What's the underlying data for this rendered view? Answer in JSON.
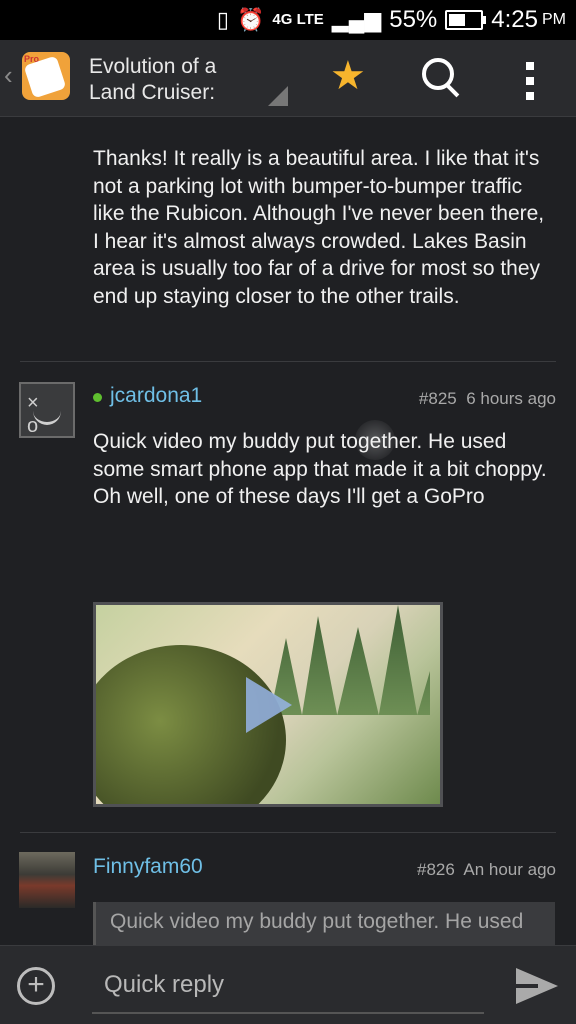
{
  "status_bar": {
    "vibrate_icon": "vibrate-icon",
    "alarm_icon": "alarm-icon",
    "network": "4G LTE",
    "signal_icon": "signal-icon",
    "battery": "55%",
    "battery_level": 0.55,
    "time": "4:25",
    "ampm": "PM"
  },
  "action_bar": {
    "title_line1": "Evolution of a",
    "title_line2": "Land Cruiser:",
    "app_icon_badge": "Pro",
    "star_icon": "star-icon",
    "search_icon": "search-icon",
    "menu_icon": "overflow-menu-icon",
    "accent": "#f7b52d"
  },
  "posts": [
    {
      "text": "Thanks! It really is a beautiful area. I like that it's not a parking lot with bumper-to-bumper traffic like the Rubicon. Although I've never been there, I hear it's almost always crowded. Lakes Basin area is usually too far of a drive for most so they end up staying closer to the other trails."
    },
    {
      "username": "jcardona1",
      "online": true,
      "post_number": "#825",
      "time": "6 hours ago",
      "text": "Quick video my buddy put together. He used some smart phone app that made it a bit choppy. Oh well, one of these days I'll get a GoPro",
      "video": {
        "play_icon": "play-icon"
      }
    },
    {
      "username": "Finnyfam60",
      "post_number": "#826",
      "time": "An hour ago",
      "quote": "Quick video my buddy put together. He used"
    }
  ],
  "bottom_bar": {
    "add_icon": "add-circle-icon",
    "reply_placeholder": "Quick reply",
    "send_icon": "send-icon"
  },
  "colors": {
    "background": "#1f2023",
    "username": "#6fbfe6",
    "online": "#5fbf2f"
  }
}
